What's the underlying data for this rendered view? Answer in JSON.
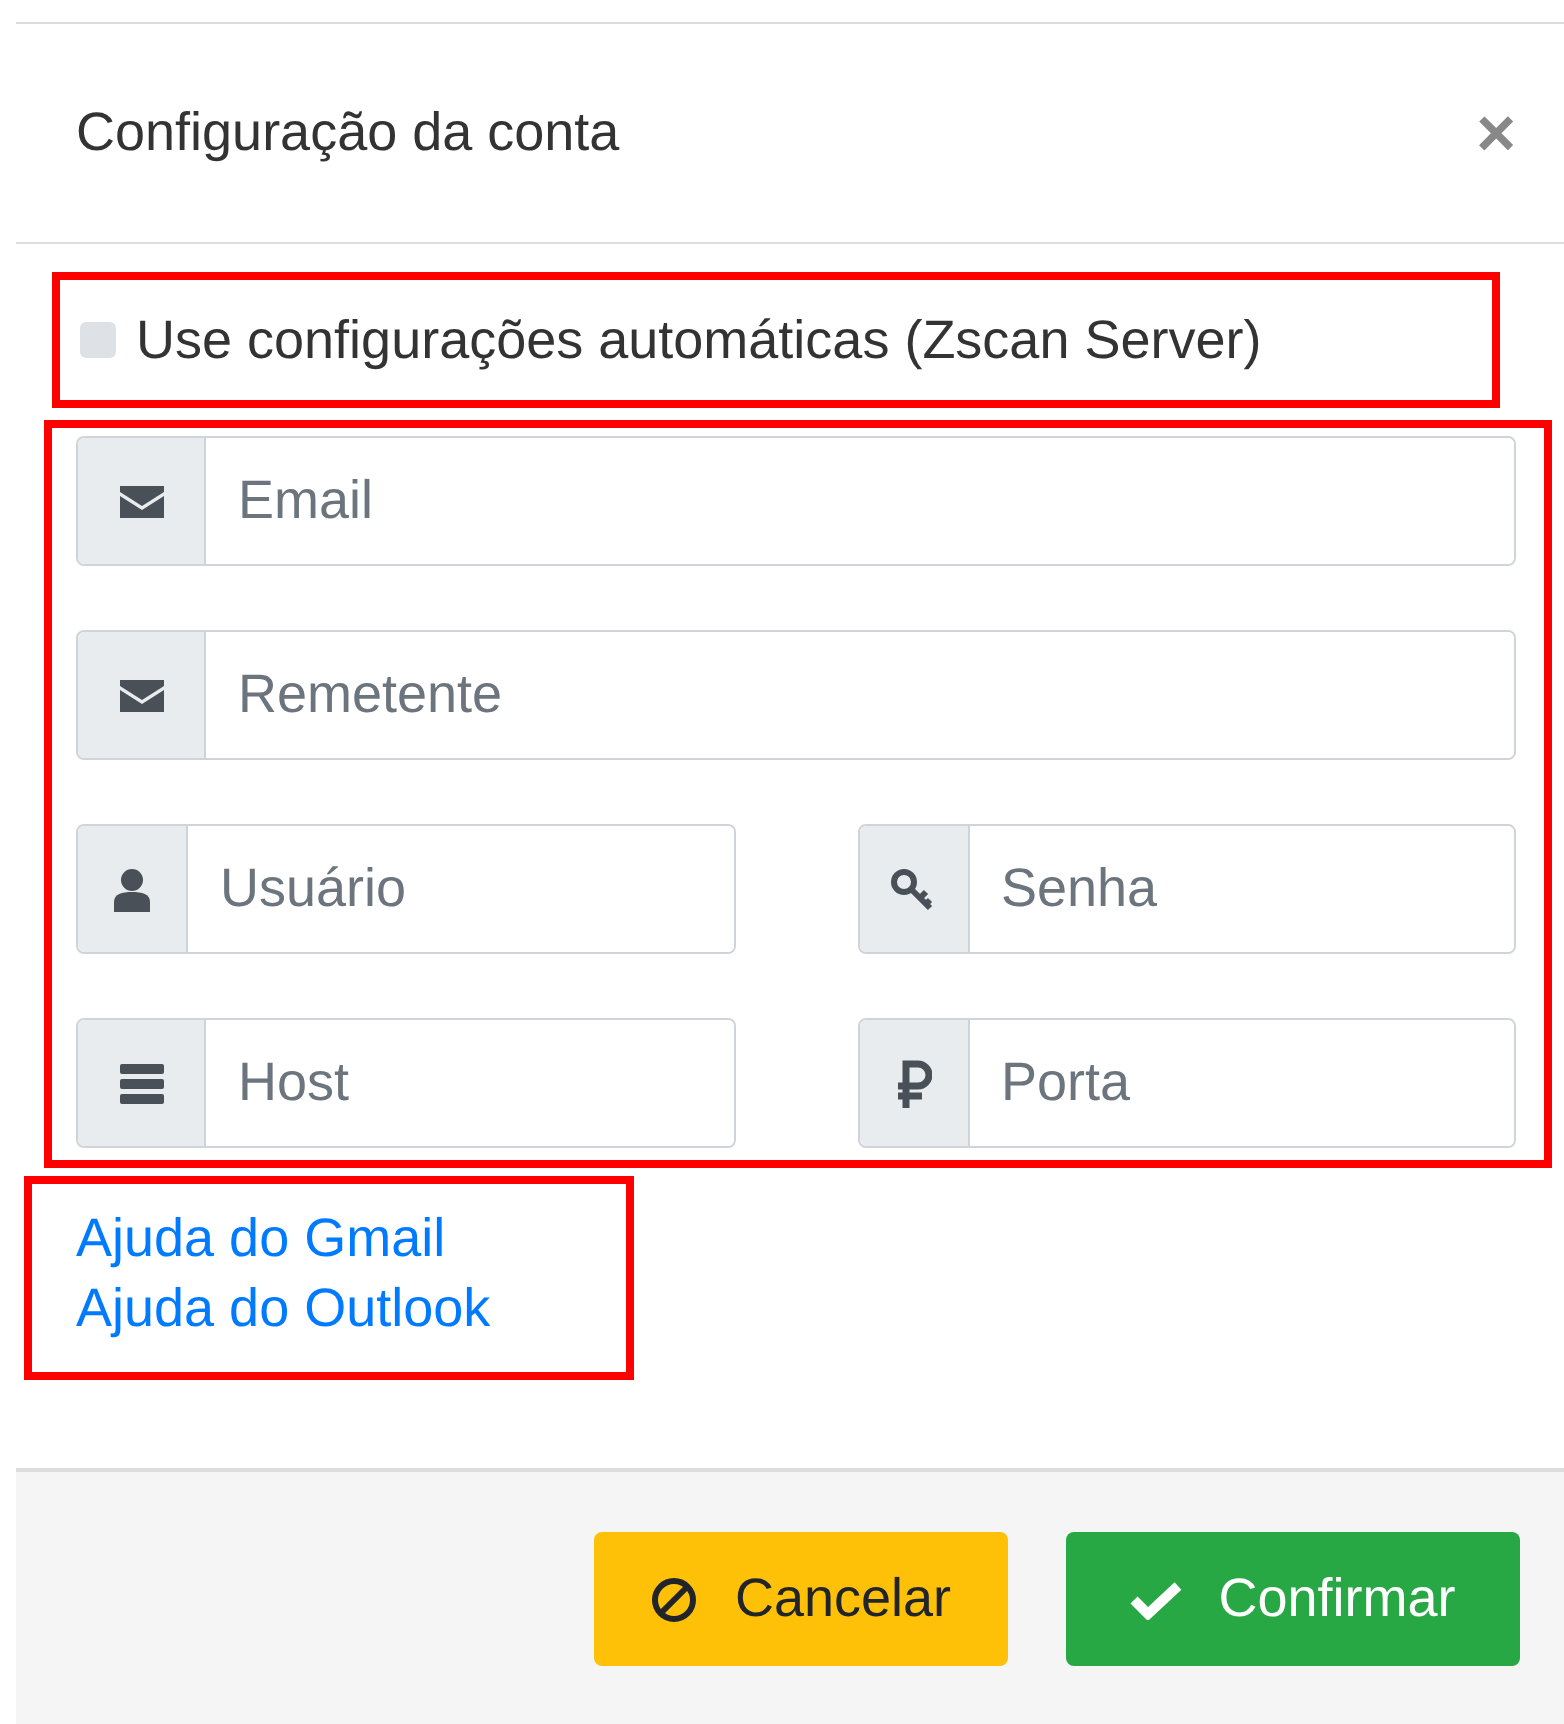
{
  "dialog": {
    "title": "Configuração da conta",
    "close": "×"
  },
  "auto_config": {
    "label": "Use configurações automáticas (Zscan Server)",
    "checked": false
  },
  "field_rows": [
    [
      {
        "placeholder": "Email"
      }
    ],
    [
      {
        "placeholder": "Remetente"
      }
    ],
    [
      {
        "placeholder": "Usuário"
      },
      {
        "placeholder": "Senha"
      }
    ],
    [
      {
        "placeholder": "Host"
      },
      {
        "placeholder": "Porta"
      }
    ]
  ],
  "help_links": [
    "Ajuda do Gmail",
    "Ajuda do Outlook"
  ],
  "buttons": [
    {
      "kind": "cancel",
      "label": "Cancelar"
    },
    {
      "kind": "confirm",
      "label": "Confirmar"
    }
  ]
}
